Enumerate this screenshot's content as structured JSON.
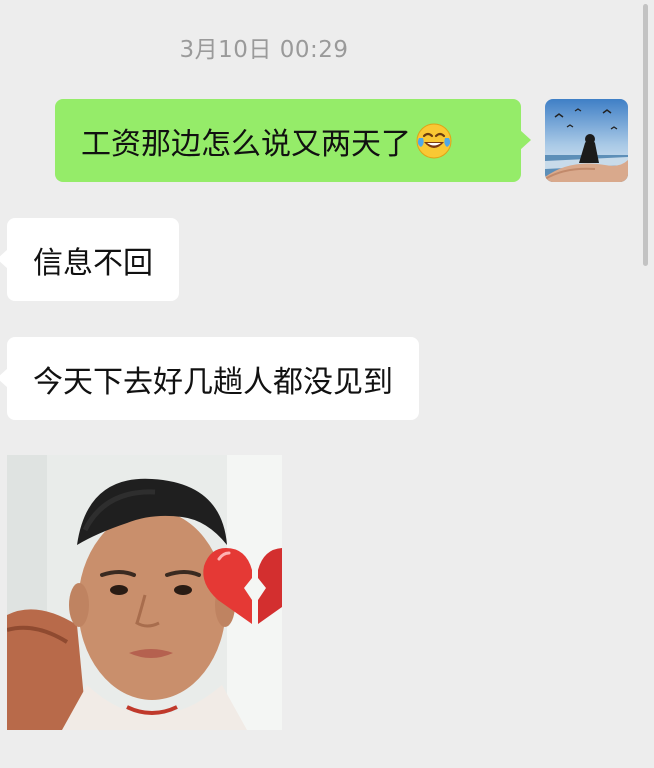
{
  "chat": {
    "timestamp": "3月10日 00:29",
    "messages": [
      {
        "direction": "out",
        "text": "工资那边怎么说又两天了",
        "emoji": "face-with-tears-of-joy"
      },
      {
        "direction": "in",
        "text": "信息不回"
      },
      {
        "direction": "in",
        "text": "今天下去好几趟人都没见到"
      },
      {
        "direction": "in",
        "type": "sticker",
        "sticker": "boy-face-with-broken-heart-sticker"
      }
    ]
  },
  "colors": {
    "background": "#ededed",
    "outgoing_bubble": "#95ec69",
    "incoming_bubble": "#ffffff",
    "timestamp_text": "#9a9a9a"
  }
}
